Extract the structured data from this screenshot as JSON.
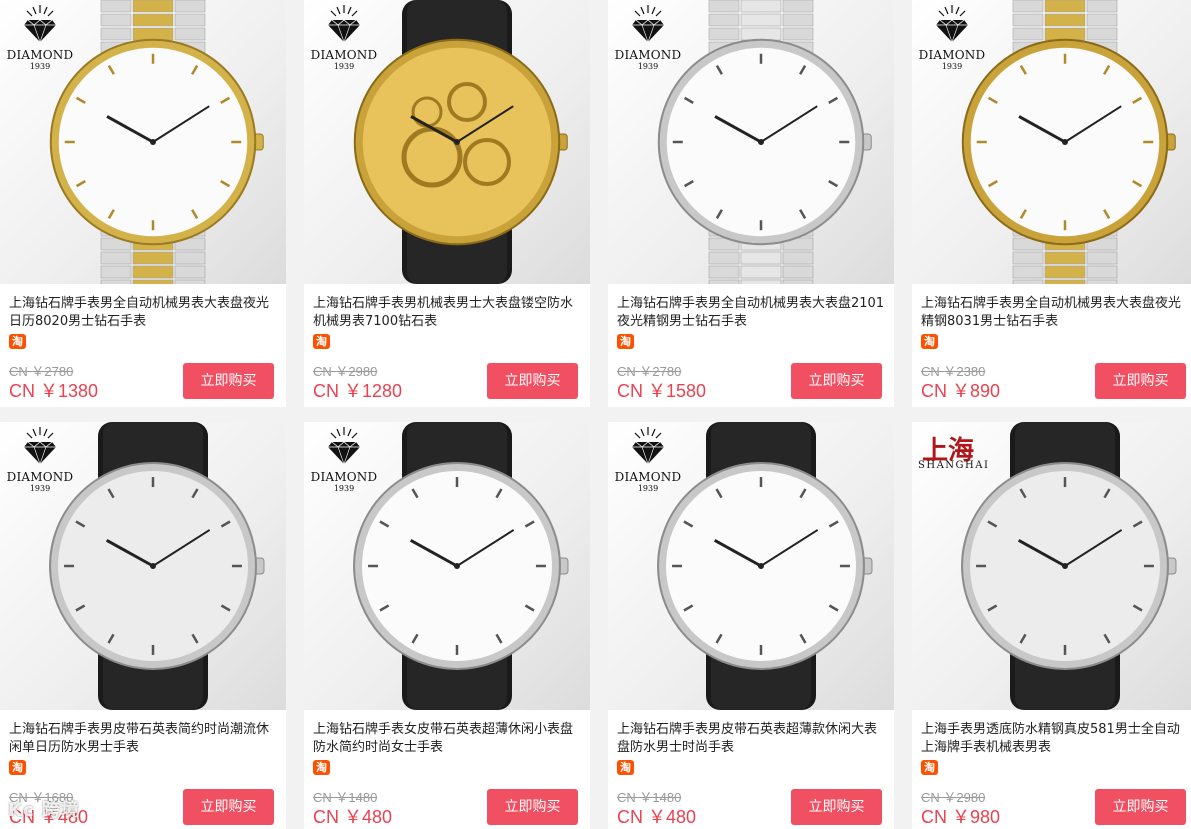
{
  "theme": {
    "accent": "#f05061",
    "price_color": "#e8424f",
    "tao_badge": "#ff5000"
  },
  "products": [
    {
      "brand": "DIAMOND",
      "brand_year": "1939",
      "title": "上海钻石牌手表男全自动机械男表大表盘夜光日历8020男士钻石手表",
      "badge": "淘",
      "old_price": "CN ￥2780",
      "price": "CN ￥1380",
      "buy_label": "立即购买",
      "watch": {
        "case": "two-tone",
        "strap": "bracelet-twotone",
        "dial": "white"
      }
    },
    {
      "brand": "DIAMOND",
      "brand_year": "1939",
      "title": "上海钻石牌手表男机械表男士大表盘镂空防水机械男表7100钻石表",
      "badge": "淘",
      "old_price": "CN ￥2980",
      "price": "CN ￥1280",
      "buy_label": "立即购买",
      "watch": {
        "case": "gold",
        "strap": "leather-black",
        "dial": "skeleton"
      }
    },
    {
      "brand": "DIAMOND",
      "brand_year": "1939",
      "title": "上海钻石牌手表男全自动机械男表大表盘2101夜光精钢男士钻石手表",
      "badge": "淘",
      "old_price": "CN ￥2780",
      "price": "CN ￥1580",
      "buy_label": "立即购买",
      "watch": {
        "case": "steel",
        "strap": "bracelet-steel",
        "dial": "white"
      }
    },
    {
      "brand": "DIAMOND",
      "brand_year": "1939",
      "title": "上海钻石牌手表男全自动机械男表大表盘夜光精钢8031男士钻石手表",
      "badge": "淘",
      "old_price": "CN ￥2380",
      "price": "CN ￥890",
      "buy_label": "立即购买",
      "watch": {
        "case": "gold",
        "strap": "bracelet-twotone",
        "dial": "white"
      }
    },
    {
      "brand": "DIAMOND",
      "brand_year": "1939",
      "title": "上海钻石牌手表男皮带石英表简约时尚潮流休闲单日历防水男士手表",
      "badge": "淘",
      "old_price": "CN ￥1680",
      "price": "CN ￥480",
      "buy_label": "立即购买",
      "watch": {
        "case": "steel",
        "strap": "leather-black",
        "dial": "silver"
      }
    },
    {
      "brand": "DIAMOND",
      "brand_year": "1939",
      "title": "上海钻石牌手表女皮带石英表超薄休闲小表盘防水简约时尚女士手表",
      "badge": "淘",
      "old_price": "CN ￥1480",
      "price": "CN ￥480",
      "buy_label": "立即购买",
      "watch": {
        "case": "steel",
        "strap": "leather-black",
        "dial": "white"
      }
    },
    {
      "brand": "DIAMOND",
      "brand_year": "1939",
      "title": "上海钻石牌手表男皮带石英表超薄款休闲大表盘防水男士时尚手表",
      "badge": "淘",
      "old_price": "CN ￥1480",
      "price": "CN ￥480",
      "buy_label": "立即购买",
      "watch": {
        "case": "steel",
        "strap": "leather-black",
        "dial": "white"
      }
    },
    {
      "brand": "SHANGHAI",
      "brand_logo": "上海",
      "title": "上海手表男透底防水精钢真皮581男士全自动上海牌手表机械表男表",
      "badge": "淘",
      "old_price": "CN ￥2980",
      "price": "CN ￥980",
      "buy_label": "立即购买",
      "watch": {
        "case": "steel",
        "strap": "leather-black",
        "dial": "silver"
      }
    }
  ],
  "watermark": "Kc 跨境"
}
